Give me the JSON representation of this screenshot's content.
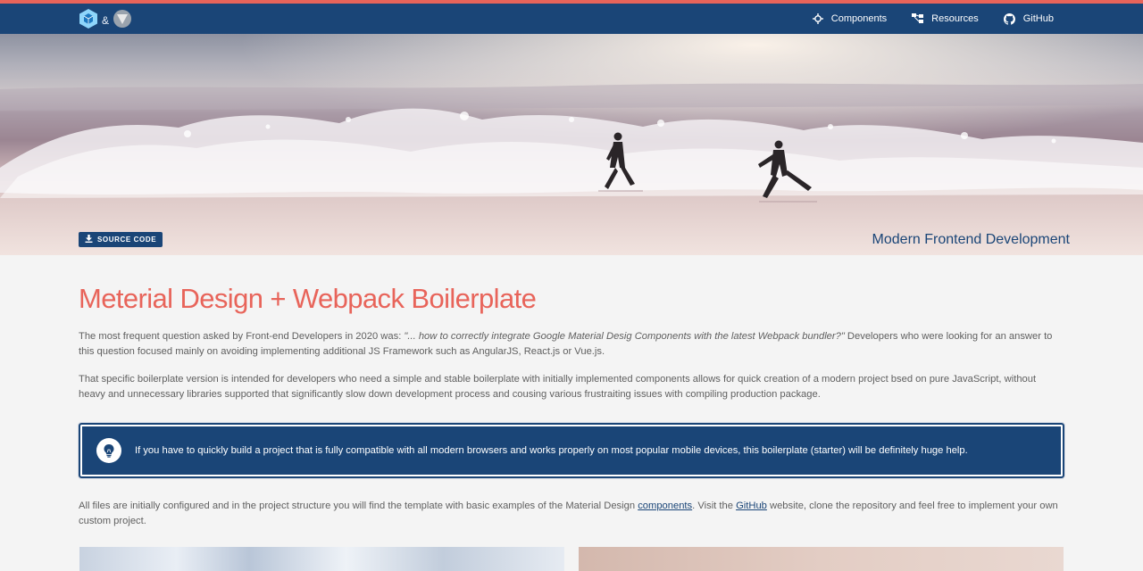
{
  "brand": {
    "amp": "&"
  },
  "nav": [
    {
      "label": "Components",
      "icon": "crosshair-icon"
    },
    {
      "label": "Resources",
      "icon": "sitemap-icon"
    },
    {
      "label": "GitHub",
      "icon": "github-icon"
    }
  ],
  "hero": {
    "source_button": "SOURCE CODE",
    "caption": "Modern Frontend Development"
  },
  "main": {
    "title": "Meterial Design + Webpack Boilerplate",
    "p1_before": "The most frequent question asked by Front-end Developers in 2020 was: ",
    "p1_quote": "\"... how to correctly integrate Google Material Desig Components with the latest Webpack bundler?\"",
    "p1_after": " Developers who were looking for an answer to this question focused mainly on avoiding implementing additional JS Framework such as AngularJS, React.js or Vue.js.",
    "p2": "That specific boilerplate version is intended for developers who need a simple and stable boilerplate with initially implemented components allows for quick creation of a modern project bsed on pure JavaScript, without heavy and unnecessary libraries supported that significantly slow down development process and cousing various frustraiting issues with compiling production package.",
    "callout": "If you have to quickly build a project that is fully compatible with all modern browsers and works properly on most popular mobile devices, this boilerplate (starter) will be definitely huge help.",
    "p3_a": "All files are initially configured and in the project structure you will find the template with basic examples of the Material Design ",
    "p3_link1": "components",
    "p3_b": ". Visit the ",
    "p3_link2": "GitHub",
    "p3_c": " website, clone the repository and feel free to implement your own custom project."
  },
  "colors": {
    "primary": "#1a4577",
    "accent": "#e8645a",
    "background": "#f4f4f4"
  }
}
